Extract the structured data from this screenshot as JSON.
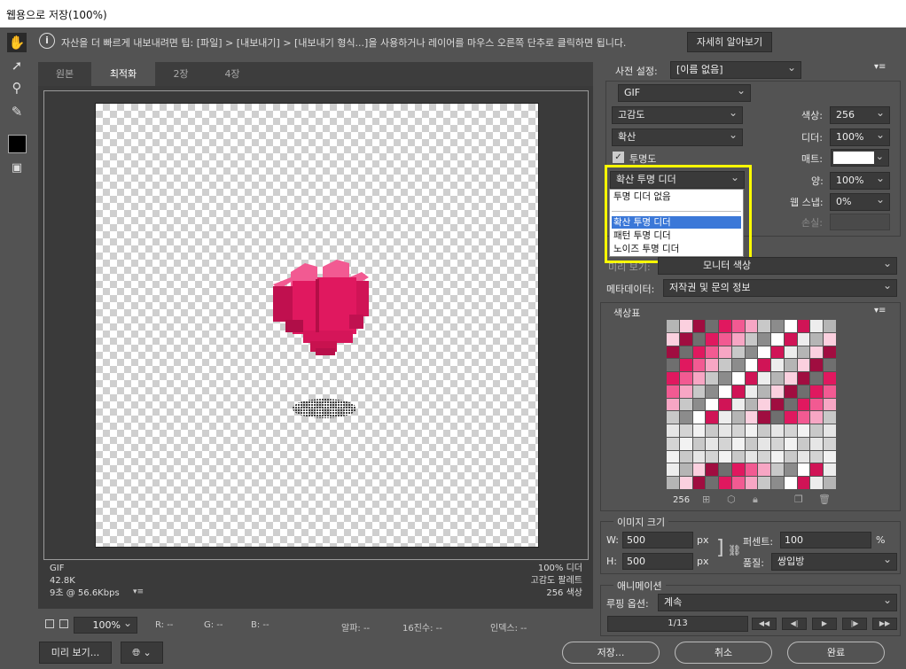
{
  "window": {
    "title": "웹용으로 저장(100%)"
  },
  "tip": {
    "text": "자산을 더 빠르게 내보내려면 팁: [파일] > [내보내기] > [내보내기 형식...]을 사용하거나 레이어를 마우스 오른쪽 단추로 클릭하면 됩니다.",
    "learn_more": "자세히 알아보기"
  },
  "tabs": [
    "원본",
    "최적화",
    "2장",
    "4장"
  ],
  "canvas_info": {
    "format": "GIF",
    "size": "42.8K",
    "time": "9초 @ 56.6Kbps",
    "dither": "100% 디더",
    "palette": "고감도 팔레트",
    "colors": "256 색상"
  },
  "status": {
    "zoom": "100%",
    "r": "R: --",
    "g": "G: --",
    "b": "B: --",
    "alpha": "알파: --",
    "hex": "16진수: --",
    "index": "인덱스: --"
  },
  "preset": {
    "label": "사전 설정:",
    "value": "[이름 없음]"
  },
  "format": {
    "value": "GIF"
  },
  "settings": {
    "reduction": "고감도",
    "dither_algo": "확산",
    "transparency_label": "투명도",
    "colors_label": "색상:",
    "colors_value": "256",
    "dither_label": "디더:",
    "dither_value": "100%",
    "matte_label": "매트:",
    "amount_label": "양:",
    "amount_value": "100%",
    "websnap_label": "웹 스냅:",
    "websnap_value": "0%",
    "lossy_label": "손실:",
    "transparency_dither": "확산 투명 디더"
  },
  "dropdown": {
    "items": [
      "투명 디더 없음",
      "확산 투명 디더",
      "패턴 투명 디더",
      "노이즈 투명 디더"
    ],
    "selected": "확산 투명 디더"
  },
  "preview": {
    "label": "미리 보기:",
    "value": "모니터 색상"
  },
  "metadata": {
    "label": "메타데이터:",
    "value": "저작권 및 문의 정보"
  },
  "color_table": {
    "title": "색상표",
    "count": "256"
  },
  "image_size": {
    "title": "이미지 크기",
    "w_label": "W:",
    "w_value": "500",
    "h_label": "H:",
    "h_value": "500",
    "unit": "px",
    "percent_label": "퍼센트:",
    "percent_value": "100",
    "percent_unit": "%",
    "quality_label": "품질:",
    "quality_value": "쌍입방"
  },
  "animation": {
    "title": "애니메이션",
    "loop_label": "루핑 옵션:",
    "loop_value": "계속",
    "frame": "1/13"
  },
  "bottom": {
    "preview_btn": "미리 보기...",
    "save": "저장...",
    "cancel": "취소",
    "done": "완료"
  },
  "colors": {
    "accent_pink": "#e0185f",
    "highlight_yellow": "#ffff00",
    "selection_blue": "#3b78d8"
  }
}
